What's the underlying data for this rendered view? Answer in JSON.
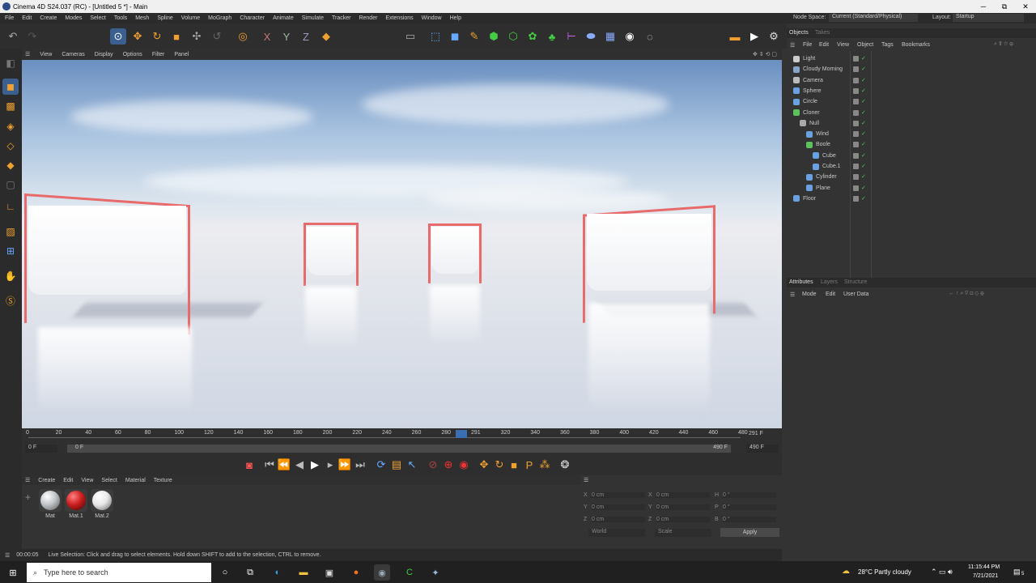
{
  "window": {
    "title": "Cinema 4D S24.037 (RC) - [Untitled 5 *] - Main",
    "minimize": "─",
    "maximize": "⧉",
    "close": "✕"
  },
  "menu": [
    "File",
    "Edit",
    "Create",
    "Modes",
    "Select",
    "Tools",
    "Mesh",
    "Spline",
    "Volume",
    "MoGraph",
    "Character",
    "Animate",
    "Simulate",
    "Tracker",
    "Render",
    "Extensions",
    "Window",
    "Help"
  ],
  "node_space": {
    "label": "Node Space:",
    "value": "Current (Standard/Physical)"
  },
  "layout": {
    "label": "Layout:",
    "value": "Startup"
  },
  "viewport_menu": [
    "View",
    "Cameras",
    "Display",
    "Options",
    "Filter",
    "Panel"
  ],
  "objects_tabs": [
    "Objects",
    "Takes"
  ],
  "objects_menu": [
    "File",
    "Edit",
    "View",
    "Object",
    "Tags",
    "Bookmarks"
  ],
  "objects": [
    {
      "name": "Light",
      "indent": 0,
      "color": "#cccccc"
    },
    {
      "name": "Cloudy Morning",
      "indent": 0,
      "color": "#8aa4c8"
    },
    {
      "name": "Camera",
      "indent": 0,
      "color": "#bbbbbb"
    },
    {
      "name": "Sphere",
      "indent": 0,
      "color": "#6aa0e0"
    },
    {
      "name": "Circle",
      "indent": 0,
      "color": "#6aa0e0"
    },
    {
      "name": "Cloner",
      "indent": 0,
      "color": "#5cc05c"
    },
    {
      "name": "Null",
      "indent": 1,
      "color": "#aaaaaa"
    },
    {
      "name": "Wind",
      "indent": 2,
      "color": "#6aa0e0"
    },
    {
      "name": "Boole",
      "indent": 2,
      "color": "#5cc05c"
    },
    {
      "name": "Cube",
      "indent": 3,
      "color": "#6aa0e0"
    },
    {
      "name": "Cube.1",
      "indent": 3,
      "color": "#6aa0e0"
    },
    {
      "name": "Cylinder",
      "indent": 2,
      "color": "#6aa0e0"
    },
    {
      "name": "Plane",
      "indent": 2,
      "color": "#6aa0e0"
    },
    {
      "name": "Floor",
      "indent": 0,
      "color": "#6aa0e0"
    }
  ],
  "attributes_tabs": [
    "Attributes",
    "Layers",
    "Structure"
  ],
  "attributes_menu": [
    "Mode",
    "Edit",
    "User Data"
  ],
  "timeline": {
    "ticks": [
      "0",
      "20",
      "40",
      "60",
      "80",
      "100",
      "120",
      "140",
      "160",
      "180",
      "200",
      "220",
      "240",
      "260",
      "280",
      "291",
      "320",
      "340",
      "360",
      "380",
      "400",
      "420",
      "440",
      "460",
      "480"
    ],
    "current_frame": "291 F",
    "start": "0 F",
    "range_start": "0 F",
    "range_end": "490 F",
    "end": "490 F",
    "current": 291,
    "max": 490
  },
  "material_menu": [
    "Create",
    "Edit",
    "View",
    "Select",
    "Material",
    "Texture"
  ],
  "materials": [
    {
      "name": "Mat",
      "color": "#c0c4c8"
    },
    {
      "name": "Mat.1",
      "color": "#cc1f1f"
    },
    {
      "name": "Mat.2",
      "color": "#e8e8e8"
    }
  ],
  "coords": {
    "rows": [
      {
        "a": "X",
        "av": "0 cm",
        "b": "X",
        "bv": "0 cm",
        "c": "H",
        "cv": "0 °"
      },
      {
        "a": "Y",
        "av": "0 cm",
        "b": "Y",
        "bv": "0 cm",
        "c": "P",
        "cv": "0 °"
      },
      {
        "a": "Z",
        "av": "0 cm",
        "b": "Z",
        "bv": "0 cm",
        "c": "B",
        "cv": "0 °"
      }
    ],
    "world": "World",
    "scale": "Scale",
    "apply": "Apply"
  },
  "status": {
    "time": "00:00:05",
    "message": "Live Selection: Click and drag to select elements. Hold down SHIFT to add to the selection, CTRL to remove."
  },
  "taskbar": {
    "search_placeholder": "Type here to search",
    "weather": "28°C  Partly cloudy",
    "time": "11:15:44 PM",
    "date": "7/21/2021",
    "notifications": "5"
  }
}
